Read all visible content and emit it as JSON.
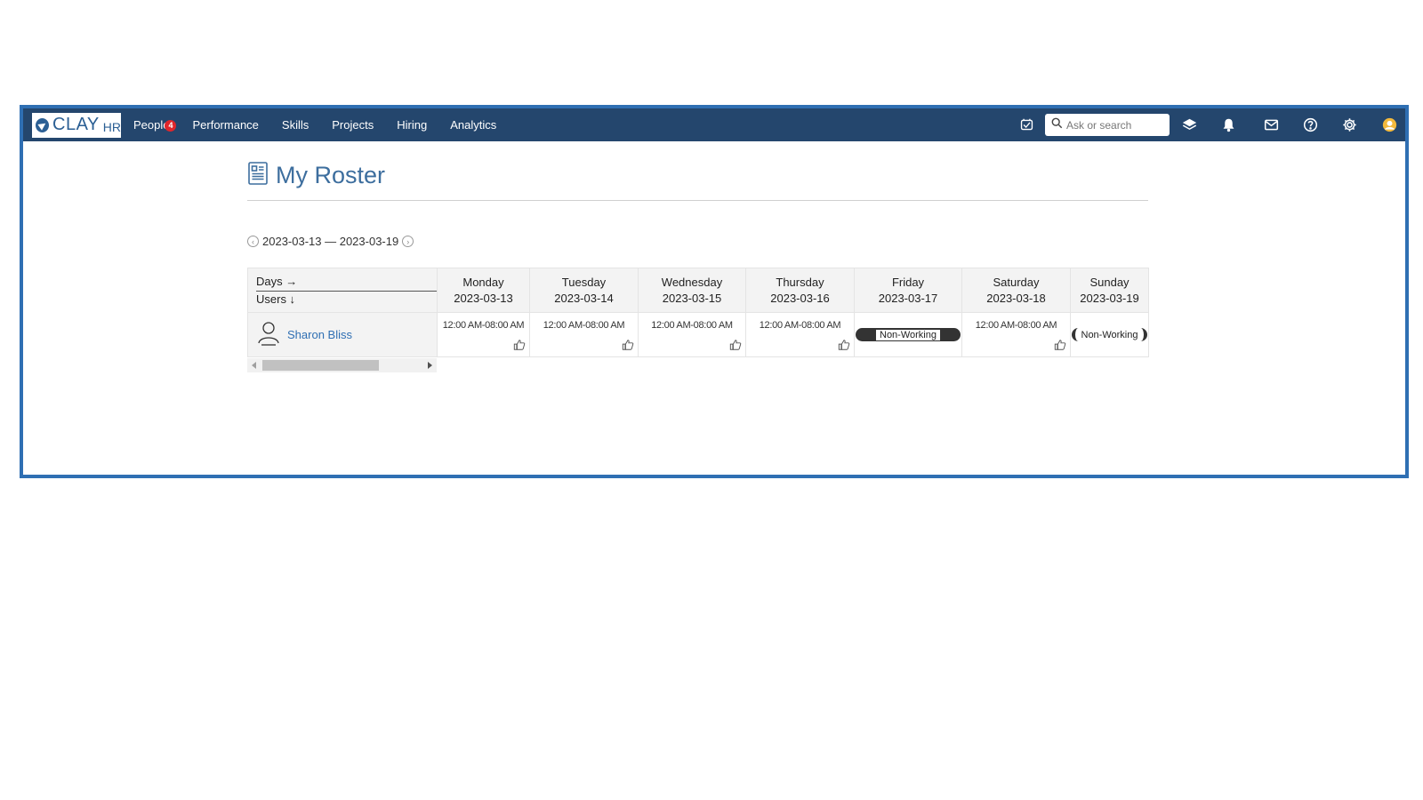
{
  "brand": {
    "name": "CLAY",
    "suffix": "HR"
  },
  "nav": {
    "items": [
      {
        "label": "People",
        "badge": "4"
      },
      {
        "label": "Performance"
      },
      {
        "label": "Skills"
      },
      {
        "label": "Projects"
      },
      {
        "label": "Hiring"
      },
      {
        "label": "Analytics"
      }
    ]
  },
  "search": {
    "placeholder": "Ask or search"
  },
  "page": {
    "title": "My Roster"
  },
  "week": {
    "range": "2023-03-13 — 2023-03-19"
  },
  "roster": {
    "corner": {
      "days": "Days →",
      "users": "Users ↓"
    },
    "days": [
      {
        "name": "Monday",
        "date": "2023-03-13"
      },
      {
        "name": "Tuesday",
        "date": "2023-03-14"
      },
      {
        "name": "Wednesday",
        "date": "2023-03-15"
      },
      {
        "name": "Thursday",
        "date": "2023-03-16"
      },
      {
        "name": "Friday",
        "date": "2023-03-17"
      },
      {
        "name": "Saturday",
        "date": "2023-03-18"
      },
      {
        "name": "Sunday",
        "date": "2023-03-19"
      }
    ],
    "rows": [
      {
        "user": "Sharon Bliss",
        "cells": [
          "12:00 AM-08:00 AM",
          "12:00 AM-08:00 AM",
          "12:00 AM-08:00 AM",
          "12:00 AM-08:00 AM",
          "Non-Working",
          "12:00 AM-08:00 AM",
          "Non-Working"
        ]
      }
    ]
  },
  "colors": {
    "nav_bg": "#24466d",
    "frame_border": "#2f6fb3",
    "title": "#3d6e9e",
    "badge": "#e0262b",
    "link": "#2f6fb3"
  },
  "icons": [
    "inbox-icon",
    "search-icon",
    "layers-icon",
    "bell-icon",
    "mail-icon",
    "help-icon",
    "gear-icon",
    "avatar-icon",
    "roster-icon",
    "user-icon",
    "thumbs-up-icon"
  ]
}
